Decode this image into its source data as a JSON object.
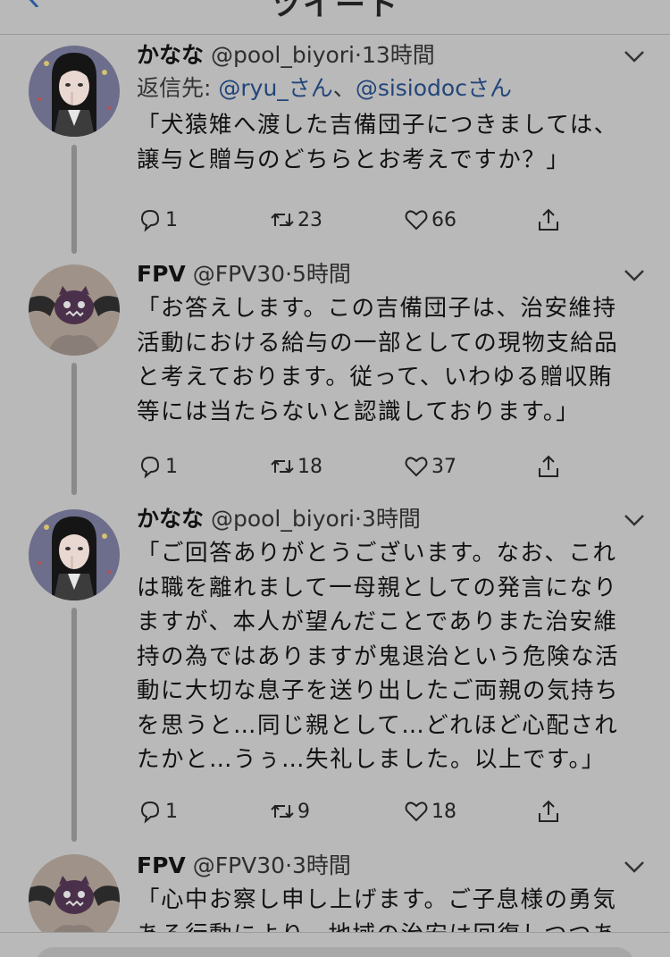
{
  "nav": {
    "title": "ツイート"
  },
  "tweets": [
    {
      "name": "かなな",
      "handle": "@pool_biyori",
      "dot": "·",
      "time": "13時間",
      "reply_prefix": "返信先: ",
      "reply_mention1": "@ryu_さん",
      "reply_sep": "、",
      "reply_mention2": "@sisiodocさん",
      "lines": [
        "「犬猿雉へ渡した吉備団子につきましては、",
        "譲与と贈与のどちらとお考えですか？」"
      ],
      "replies": "1",
      "retweets": "23",
      "likes": "66"
    },
    {
      "name": "FPV",
      "handle": "@FPV30",
      "dot": "·",
      "time": "5時間",
      "lines": [
        "「お答えします。この吉備団子は、治安維持",
        "活動における給与の一部としての現物支給品",
        "と考えております。従って、いわゆる贈収賄",
        "等には当たらないと認識しております。」"
      ],
      "replies": "1",
      "retweets": "18",
      "likes": "37"
    },
    {
      "name": "かなな",
      "handle": "@pool_biyori",
      "dot": "·",
      "time": "3時間",
      "lines": [
        "「ご回答ありがとうございます。なお、これ",
        "は職を離れまして一母親としての発言になり",
        "ますが、本人が望んだことでありまた治安維",
        "持の為ではありますが鬼退治という危険な活",
        "動に大切な息子を送り出したご両親の気持ち",
        "を思うと…同じ親として…どれほど心配され",
        "たかと…うぅ…失礼しました。以上です。」"
      ],
      "replies": "1",
      "retweets": "9",
      "likes": "18"
    },
    {
      "name": "FPV",
      "handle": "@FPV30",
      "dot": "·",
      "time": "3時間",
      "lines": [
        "「心中お察し申し上げます。ご子息様の勇気",
        "ある行動により、地域の治安は回復しつつあ"
      ]
    }
  ]
}
